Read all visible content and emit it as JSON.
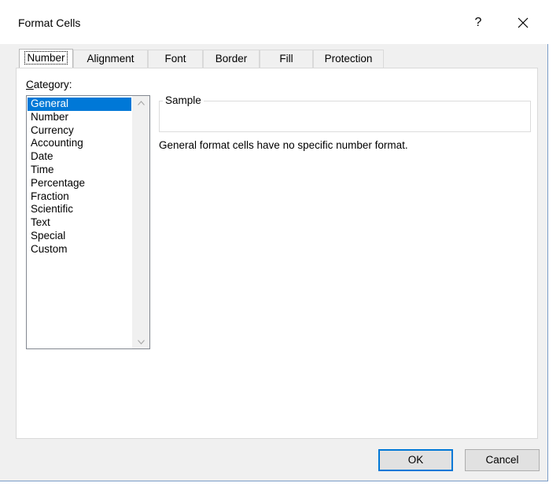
{
  "window": {
    "title": "Format Cells",
    "help_label": "?"
  },
  "tabs": [
    {
      "label": "Number",
      "active": true
    },
    {
      "label": "Alignment",
      "active": false
    },
    {
      "label": "Font",
      "active": false
    },
    {
      "label": "Border",
      "active": false
    },
    {
      "label": "Fill",
      "active": false
    },
    {
      "label": "Protection",
      "active": false
    }
  ],
  "category": {
    "label_accel": "C",
    "label_rest": "ategory:",
    "items": [
      "General",
      "Number",
      "Currency",
      "Accounting",
      "Date",
      "Time",
      "Percentage",
      "Fraction",
      "Scientific",
      "Text",
      "Special",
      "Custom"
    ],
    "selected": "General"
  },
  "sample": {
    "label": "Sample",
    "value": ""
  },
  "description": "General format cells have no specific number format.",
  "buttons": {
    "ok": "OK",
    "cancel": "Cancel"
  },
  "colors": {
    "selection": "#0078d7",
    "accent_border": "#7a9cc8"
  }
}
